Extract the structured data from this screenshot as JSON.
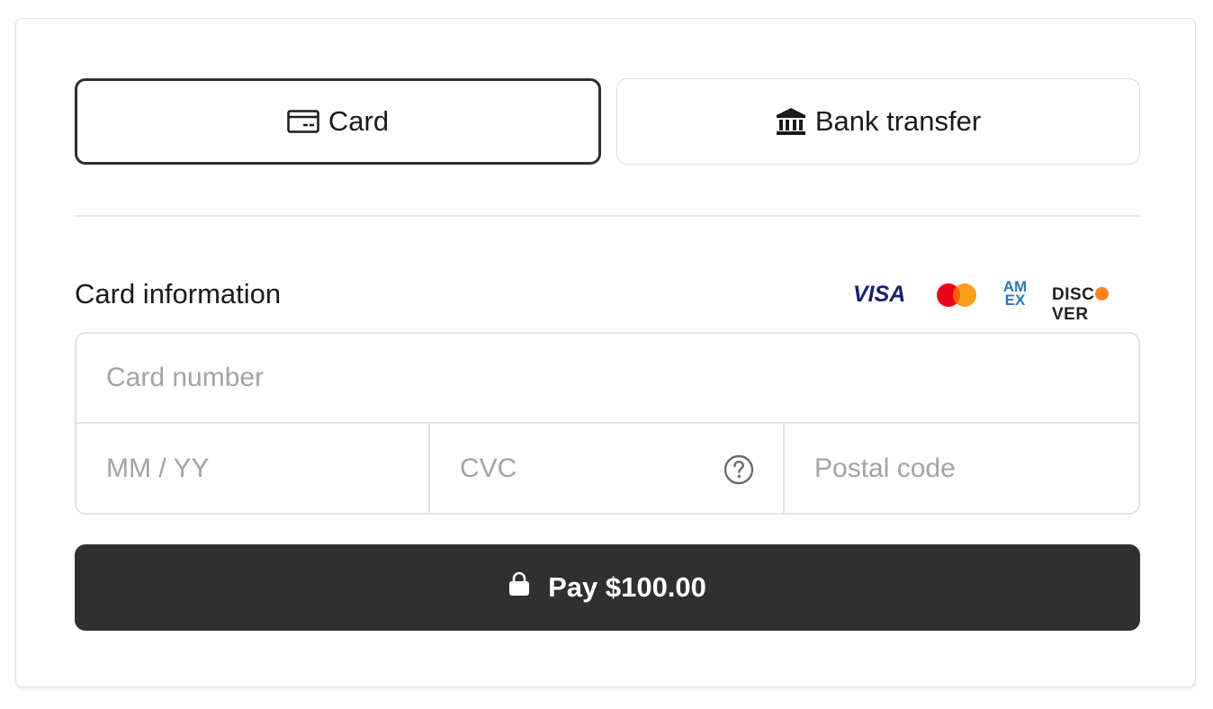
{
  "tabs": [
    {
      "label": "Card",
      "icon": "credit-card-icon",
      "selected": true
    },
    {
      "label": "Bank transfer",
      "icon": "bank-icon",
      "selected": false
    }
  ],
  "card_section": {
    "label": "Card information",
    "brands": [
      {
        "name": "VISA",
        "icon": "visa-logo",
        "color": "#1a1f71"
      },
      {
        "name": "Mastercard",
        "icon": "mastercard-logo",
        "colors": [
          "#eb001b",
          "#f79e1b"
        ]
      },
      {
        "name": "AM EX",
        "icon": "amex-logo",
        "color": "#2e77bb"
      },
      {
        "name": "DISCOVER",
        "icon": "discover-logo",
        "color": "#f58220"
      }
    ],
    "fields": {
      "card_number": {
        "placeholder": "Card number",
        "value": ""
      },
      "expiry": {
        "placeholder": "MM / YY",
        "value": ""
      },
      "cvc": {
        "placeholder": "CVC",
        "value": "",
        "help_icon": "question-circle-icon"
      },
      "postal": {
        "placeholder": "Postal code",
        "value": ""
      }
    }
  },
  "pay_button": {
    "label": "Pay $100.00",
    "icon": "lock-icon",
    "background": "#303030"
  }
}
